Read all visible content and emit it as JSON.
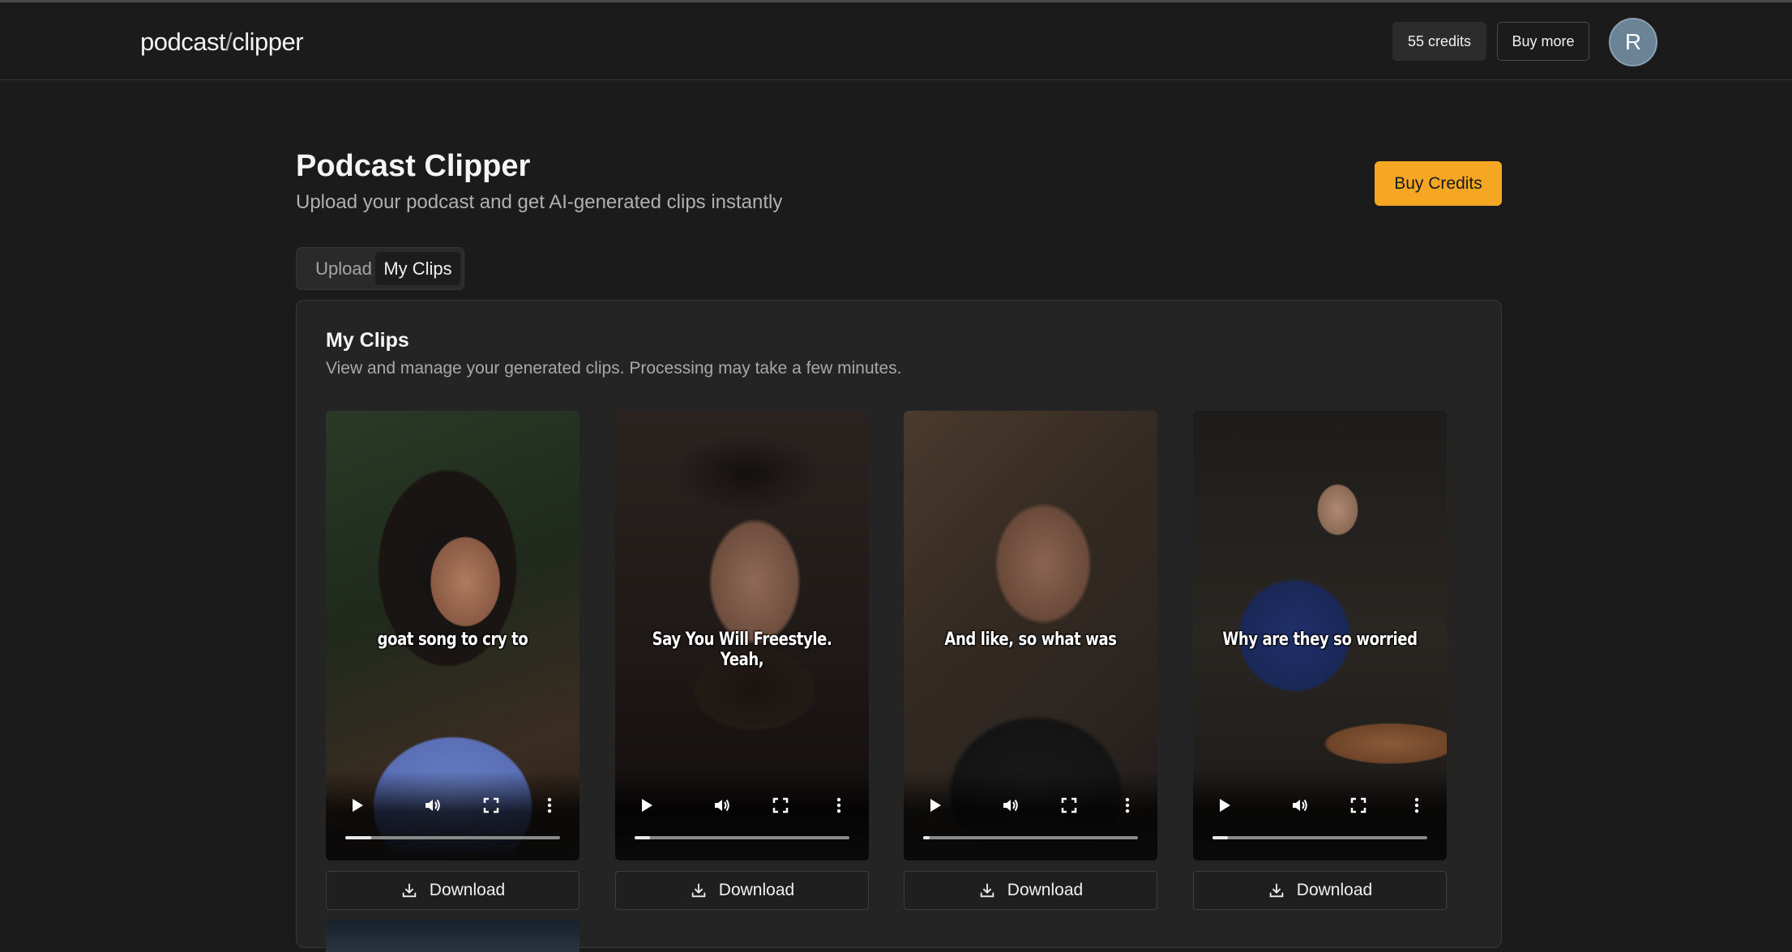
{
  "navbar": {
    "brand_left": "podcast",
    "brand_slash": "/",
    "brand_right": "clipper",
    "credits_label": "55 credits",
    "buy_more_label": "Buy more",
    "avatar_initial": "R"
  },
  "header": {
    "title": "Podcast Clipper",
    "subtitle": "Upload your podcast and get AI-generated clips instantly",
    "buy_credits_label": "Buy Credits"
  },
  "tabs": [
    {
      "label": "Upload",
      "active": false
    },
    {
      "label": "My Clips",
      "active": true
    }
  ],
  "clips_section": {
    "title": "My Clips",
    "description": "View and manage your generated clips. Processing may take a few minutes.",
    "clips": [
      {
        "caption": "goat song to cry to",
        "download_label": "Download",
        "progress": 0.12
      },
      {
        "caption": "Say You Will Freestyle. Yeah,",
        "download_label": "Download",
        "progress": 0.07
      },
      {
        "caption": "And like, so what was",
        "download_label": "Download",
        "progress": 0.03
      },
      {
        "caption": "Why are they so worried",
        "download_label": "Download",
        "progress": 0.07
      }
    ]
  },
  "colors": {
    "background": "#1b1b1b",
    "card": "#242424",
    "accent": "#f5a623",
    "avatar": "#6b8396"
  },
  "icons": [
    "play-icon",
    "volume-icon",
    "fullscreen-icon",
    "more-options-icon",
    "download-icon"
  ]
}
